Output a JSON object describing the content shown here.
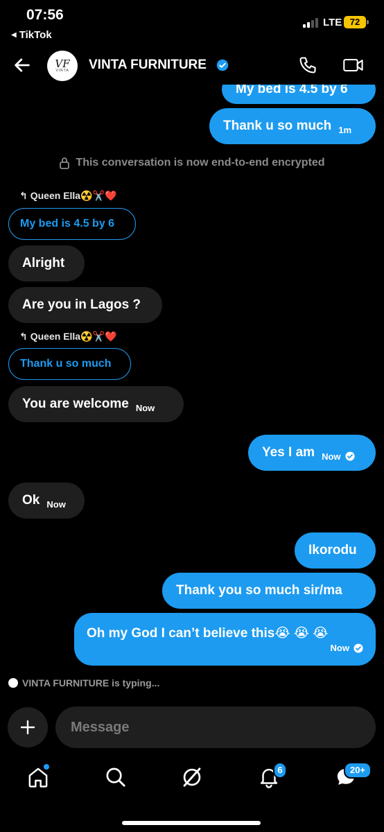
{
  "status_bar": {
    "time": "07:56",
    "back_app": "TikTok",
    "network": "LTE",
    "battery": "72"
  },
  "header": {
    "contact_name": "VINTA FURNITURE",
    "avatar_text": "VINTA",
    "verified_icon": "verified-badge-icon",
    "accent_color": "#1d9bf0"
  },
  "chat": {
    "partial_top_message": "My bed is 4.5 by 6",
    "messages_top": {
      "thanks": {
        "text": "Thank u so much",
        "time": "1m"
      }
    },
    "encrypted_notice": "This conversation is now end-to-end encrypted",
    "reply_1": {
      "label": "Queen Ella☢️✂️❤️",
      "quoted": "My bed is 4.5 by 6"
    },
    "in_alright": "Alright",
    "in_lagos": "Are you in Lagos ?",
    "reply_2": {
      "label": "Queen Ella☢️✂️❤️",
      "quoted": "Thank u so much"
    },
    "in_welcome": {
      "text": "You are welcome",
      "time": "Now"
    },
    "out_yes": {
      "text": "Yes I am",
      "time": "Now"
    },
    "in_ok": {
      "text": "Ok",
      "time": "Now"
    },
    "out_ikorodu": "Ikorodu",
    "out_thanks_sir": "Thank you so much sir/ma",
    "out_omg": {
      "text": "Oh my God I can’t believe this😭 😭 😭",
      "time": "Now"
    },
    "typing": "VINTA FURNITURE is typing..."
  },
  "composer": {
    "placeholder": "Message"
  },
  "nav": {
    "notifications_badge": "6",
    "messages_badge": "20+"
  }
}
